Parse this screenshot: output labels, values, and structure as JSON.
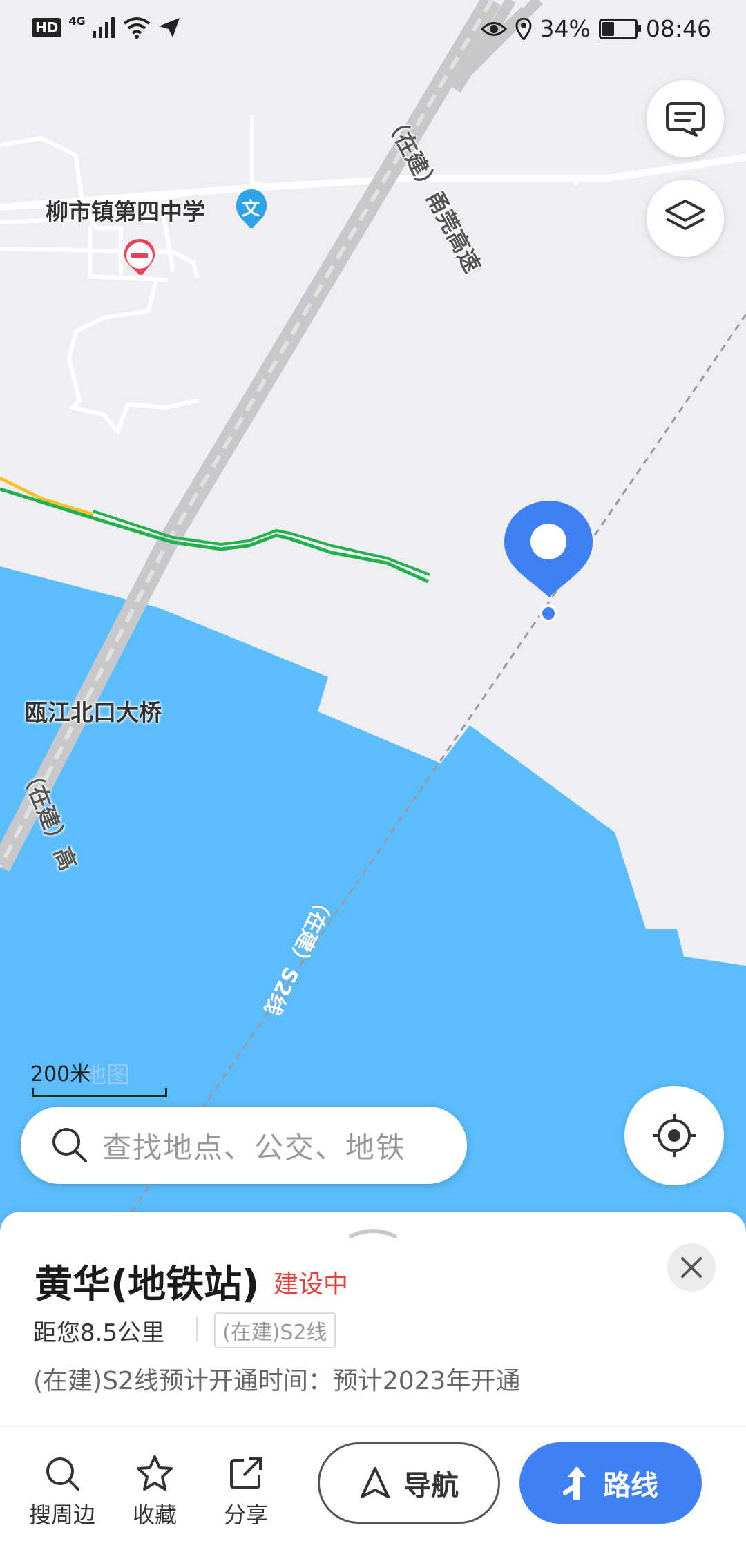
{
  "status_bar": {
    "hd": "HD",
    "network": "4G",
    "battery_percent": "34%",
    "battery_level": 0.34,
    "time": "08:46"
  },
  "map": {
    "labels": {
      "school": "柳市镇第四中学",
      "road_name": "（在建）甬莞高速",
      "bridge": "瓯江北口大桥",
      "bridge_road": "（在建）高",
      "metro_line": "（在建）S2线"
    },
    "poi_badge": "文",
    "scale_text": "200米",
    "watermark": "地图",
    "colors": {
      "water": "#5bbdfb",
      "land": "#efeff3",
      "marker": "#3f80f5",
      "green_road": "#22b14c",
      "yellow_road": "#f3c12f"
    }
  },
  "search": {
    "placeholder": "查找地点、公交、地铁"
  },
  "poi_card": {
    "title": "黄华(地铁站)",
    "status": "建设中",
    "distance": "距您8.5公里",
    "line_tag": "(在建)S2线",
    "open_info": "(在建)S2线预计开通时间：预计2023年开通"
  },
  "actions": {
    "search_nearby": "搜周边",
    "favorite": "收藏",
    "share": "分享",
    "navigate": "导航",
    "route": "路线"
  },
  "icons": {
    "feedback": "chat-bubble-icon",
    "layers": "layers-icon",
    "locate": "crosshair-icon",
    "search": "search-icon",
    "close": "close-icon"
  }
}
